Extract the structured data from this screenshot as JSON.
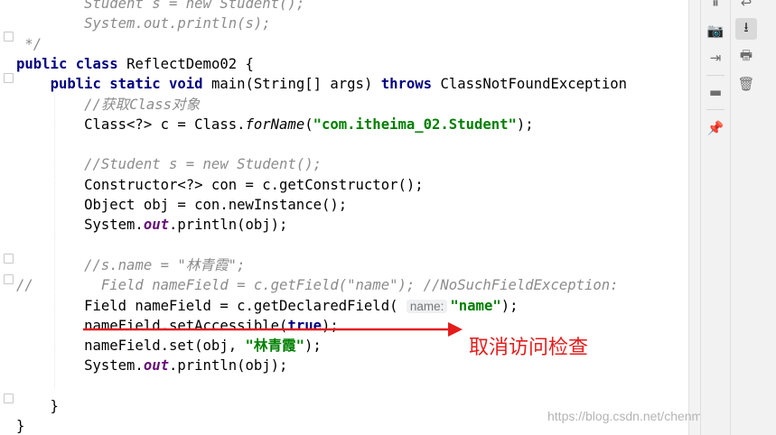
{
  "editor": {
    "lines": [
      {
        "id": "l01",
        "parts": [
          {
            "t": "        ",
            "c": ""
          },
          {
            "t": "Student s = new Student();",
            "c": "cm"
          }
        ]
      },
      {
        "id": "l02",
        "parts": [
          {
            "t": "        ",
            "c": ""
          },
          {
            "t": "System.out.println(s);",
            "c": "cm"
          }
        ]
      },
      {
        "id": "l03",
        "parts": [
          {
            "t": " */",
            "c": "cm"
          }
        ]
      },
      {
        "id": "l04",
        "parts": [
          {
            "t": "public class ",
            "c": "kw"
          },
          {
            "t": "ReflectDemo02 {",
            "c": ""
          }
        ]
      },
      {
        "id": "l05",
        "parts": [
          {
            "t": "    ",
            "c": ""
          },
          {
            "t": "public static void ",
            "c": "kw"
          },
          {
            "t": "main(String[] args) ",
            "c": ""
          },
          {
            "t": "throws ",
            "c": "kw"
          },
          {
            "t": "ClassNotFoundException",
            "c": ""
          }
        ]
      },
      {
        "id": "l06",
        "parts": [
          {
            "t": "        ",
            "c": ""
          },
          {
            "t": "//获取Class对象",
            "c": "cm"
          }
        ]
      },
      {
        "id": "l07",
        "parts": [
          {
            "t": "        Class<?> c = Class.",
            "c": ""
          },
          {
            "t": "forName",
            "c": "it"
          },
          {
            "t": "(",
            "c": ""
          },
          {
            "t": "\"com.itheima_02.Student\"",
            "c": "str"
          },
          {
            "t": ");",
            "c": ""
          }
        ]
      },
      {
        "id": "l08",
        "parts": [
          {
            "t": "",
            "c": ""
          }
        ]
      },
      {
        "id": "l09",
        "parts": [
          {
            "t": "        ",
            "c": ""
          },
          {
            "t": "//Student s = new Student();",
            "c": "cm"
          }
        ]
      },
      {
        "id": "l10",
        "parts": [
          {
            "t": "        Constructor<?> con = c.getConstructor();",
            "c": ""
          }
        ]
      },
      {
        "id": "l11",
        "parts": [
          {
            "t": "        Object obj = con.newInstance();",
            "c": ""
          }
        ]
      },
      {
        "id": "l12",
        "parts": [
          {
            "t": "        System.",
            "c": ""
          },
          {
            "t": "out",
            "c": "st"
          },
          {
            "t": ".println(obj);",
            "c": ""
          }
        ]
      },
      {
        "id": "l13",
        "parts": [
          {
            "t": "",
            "c": ""
          }
        ]
      },
      {
        "id": "l14",
        "parts": [
          {
            "t": "        ",
            "c": ""
          },
          {
            "t": "//s.name = \"林青霞\";",
            "c": "cm"
          }
        ]
      },
      {
        "id": "l15",
        "parts": [
          {
            "t": "//        Field nameField = c.getField(\"name\"); //NoSuchFieldException:",
            "c": "cm"
          }
        ]
      },
      {
        "id": "l16",
        "parts": [
          {
            "t": "        Field nameField = c.getDeclaredField( ",
            "c": ""
          },
          {
            "t": "name:",
            "c": "hint"
          },
          {
            "t": "\"name\"",
            "c": "str"
          },
          {
            "t": ");",
            "c": ""
          }
        ]
      },
      {
        "id": "l17",
        "parts": [
          {
            "t": "        nameField.setAccessible(",
            "c": ""
          },
          {
            "t": "true",
            "c": "kw"
          },
          {
            "t": ");",
            "c": ""
          }
        ]
      },
      {
        "id": "l18",
        "parts": [
          {
            "t": "        nameField.set(obj, ",
            "c": ""
          },
          {
            "t": "\"林青霞\"",
            "c": "str"
          },
          {
            "t": ");",
            "c": ""
          }
        ]
      },
      {
        "id": "l19",
        "parts": [
          {
            "t": "        System.",
            "c": ""
          },
          {
            "t": "out",
            "c": "st"
          },
          {
            "t": ".println(obj);",
            "c": ""
          }
        ]
      },
      {
        "id": "l20",
        "parts": [
          {
            "t": "",
            "c": ""
          }
        ]
      },
      {
        "id": "l21",
        "parts": [
          {
            "t": "    }",
            "c": ""
          }
        ]
      },
      {
        "id": "l22",
        "parts": [
          {
            "t": "}",
            "c": ""
          }
        ]
      }
    ]
  },
  "annotation": {
    "text": "取消访问检查",
    "color": "#e41c1c"
  },
  "watermark": "https://blog.csdn.net/chenmaosang",
  "toolbar_left": {
    "buttons": [
      {
        "name": "pause-icon",
        "glyph": "⏸"
      },
      {
        "name": "camera-icon",
        "glyph": "📷"
      },
      {
        "name": "login-icon",
        "glyph": "⇥"
      },
      {
        "name": "layout-icon",
        "glyph": "▬"
      },
      {
        "name": "pin-icon",
        "glyph": "📌"
      }
    ]
  },
  "toolbar_right": {
    "buttons": [
      {
        "name": "soft-wrap-icon",
        "glyph": "↩"
      },
      {
        "name": "scroll-to-end-icon",
        "glyph": "⭳"
      },
      {
        "name": "print-icon",
        "glyph": "🖶"
      },
      {
        "name": "trash-icon",
        "glyph": "🗑"
      }
    ]
  }
}
